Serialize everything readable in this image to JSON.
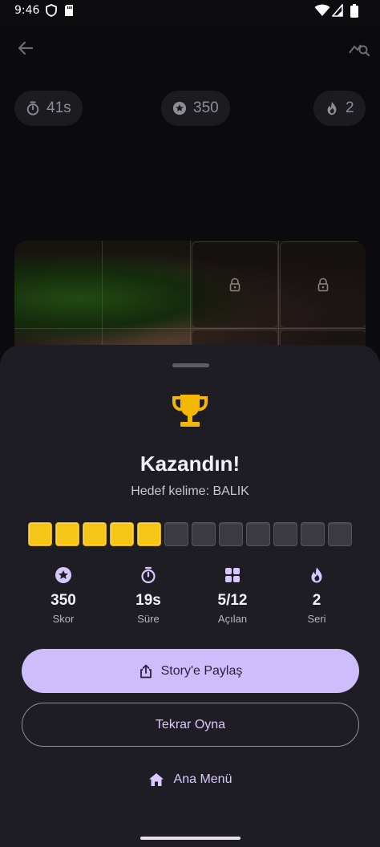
{
  "status_bar": {
    "time": "9:46"
  },
  "game": {
    "pills": [
      {
        "icon": "stopwatch-icon",
        "value": "41s"
      },
      {
        "icon": "star-badge-icon",
        "value": "350"
      },
      {
        "icon": "flame-icon",
        "value": "2"
      }
    ]
  },
  "sheet": {
    "title": "Kazandın!",
    "subtitle": "Hedef kelime: BALIK",
    "tiles": {
      "revealed": 5,
      "total": 12
    },
    "stats": [
      {
        "icon": "star-badge-icon",
        "value": "350",
        "label": "Skor"
      },
      {
        "icon": "stopwatch-icon",
        "value": "19s",
        "label": "Süre"
      },
      {
        "icon": "grid-icon",
        "value": "5/12",
        "label": "Açılan"
      },
      {
        "icon": "flame-icon",
        "value": "2",
        "label": "Seri"
      }
    ],
    "share_label": "Story'e Paylaş",
    "replay_label": "Tekrar Oyna",
    "menu_label": "Ana Menü"
  },
  "colors": {
    "accent": "#cdbdfb",
    "accent_text": "#d9c9ff",
    "tile_on": "#f5c518",
    "trophy": "#f5b800",
    "stat_icon": "#d8c7ff"
  }
}
